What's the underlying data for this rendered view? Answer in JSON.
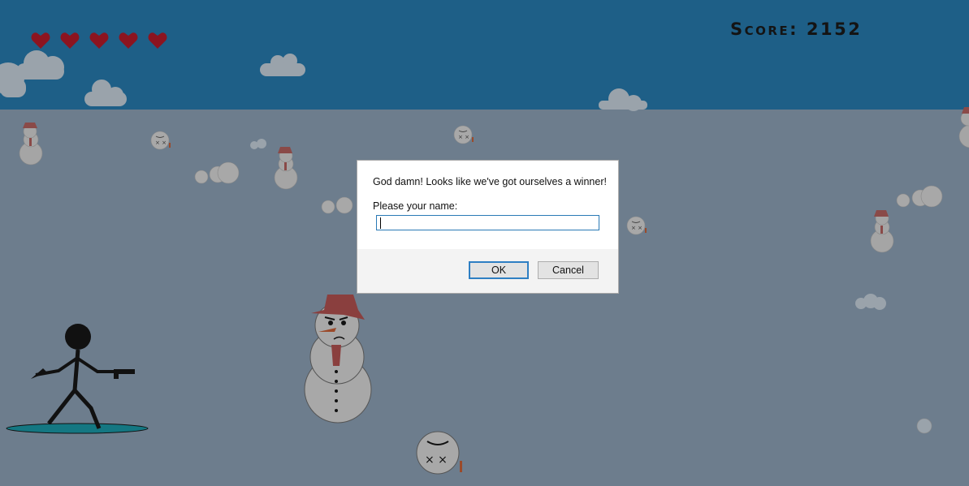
{
  "hud": {
    "lives": 5,
    "score_text": "Score: 2152"
  },
  "dialog": {
    "message": "God damn! Looks like we've got ourselves a winner!",
    "prompt": "Please your name:",
    "input_value": "",
    "ok_label": "OK",
    "cancel_label": "Cancel"
  },
  "colors": {
    "sky": "#1e5f87",
    "ground": "#6d7d8d",
    "heart": "#8c1420",
    "hat": "#b9403e",
    "snow": "#c8c8c8",
    "skateboard": "#1b8a95"
  },
  "icons": [
    "heart-icon",
    "cloud-icon",
    "snowman-icon",
    "stickman-icon",
    "gun-icon",
    "skateboard-icon"
  ]
}
